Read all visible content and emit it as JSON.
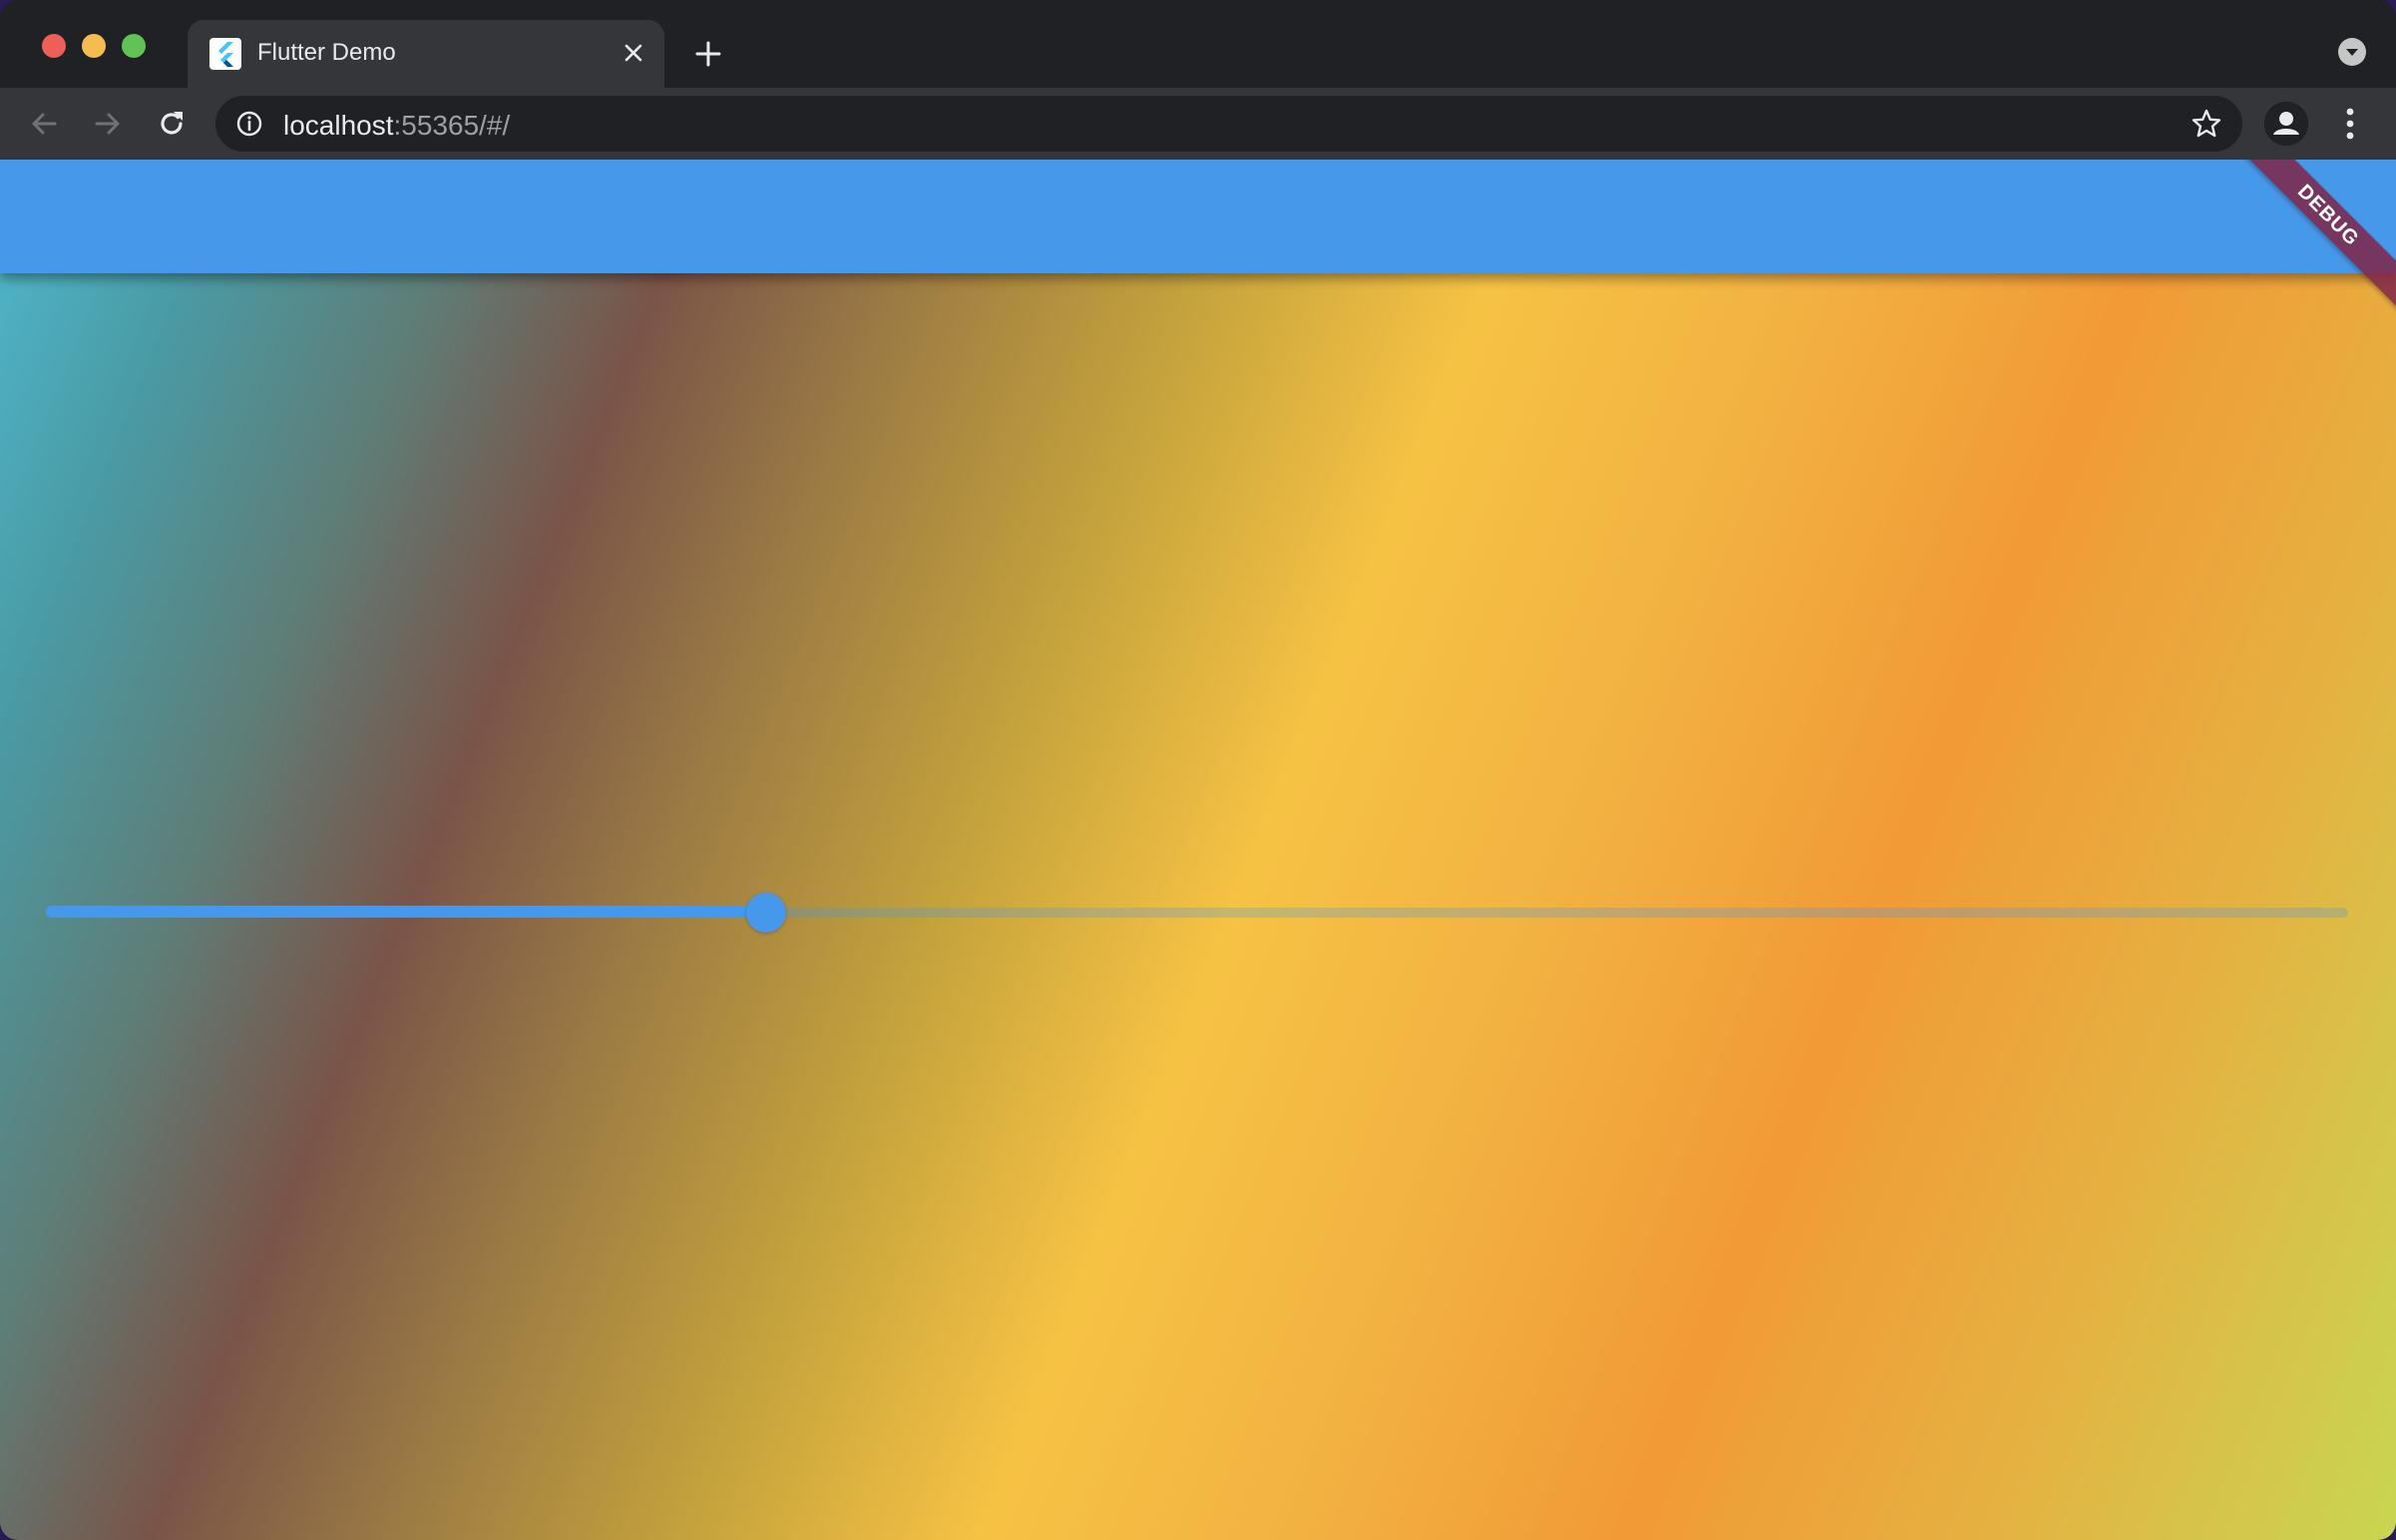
{
  "browser": {
    "tab_title": "Flutter Demo",
    "url_host": "localhost",
    "url_rest": ":55365/#/"
  },
  "icons": {
    "favicon": "flutter-logo-icon",
    "tab_close": "close-icon",
    "new_tab": "plus-icon",
    "tab_search": "chevron-down-icon",
    "back": "arrow-left-icon",
    "forward": "arrow-right-icon",
    "reload": "reload-icon",
    "site_info": "info-icon",
    "bookmark": "star-icon",
    "profile": "person-icon",
    "menu": "kebab-menu-icon"
  },
  "app": {
    "appbar_color": "#4698ea",
    "debug_banner": "DEBUG",
    "slider": {
      "value": 0.313,
      "active_color": "#4698ea"
    }
  }
}
